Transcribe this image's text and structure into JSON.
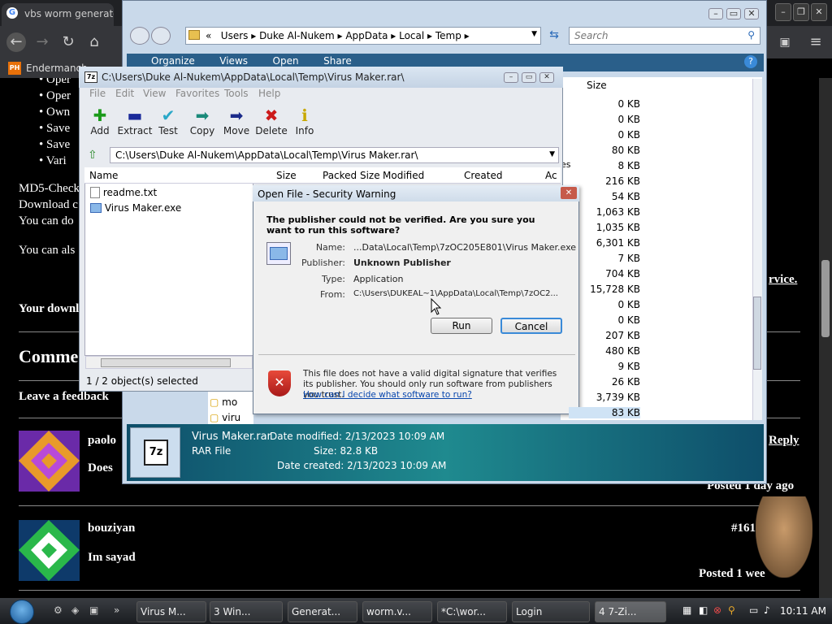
{
  "browser": {
    "tab_title": "vbs worm generato",
    "bookmark": "Endermanch",
    "bookmark_icon": "PH"
  },
  "page": {
    "bullets": [
      "Oper",
      "Oper",
      "Own",
      "Save",
      "Save",
      "Vari"
    ],
    "md5": "MD5-Check",
    "download": "Download c",
    "can_do": "You can do",
    "can_also": "You can als",
    "your_down": "Your downl",
    "service_link": "rvice.",
    "comments_heading": "Comme",
    "leave_feedback": "Leave a feedback",
    "comments": [
      {
        "author": "paolo",
        "text": "Does",
        "reply": "Reply",
        "posted": "Posted 1 day ago"
      },
      {
        "author": "bouziyan",
        "text": "Im sayad",
        "id": "#1610",
        "posted": "Posted 1 wee"
      }
    ]
  },
  "explorer": {
    "breadcrumb": [
      "«",
      "Users",
      "Duke Al-Nukem",
      "AppData",
      "Local",
      "Temp"
    ],
    "search_placeholder": "Search",
    "toolbar": [
      "Organize",
      "Views",
      "Open",
      "Share"
    ],
    "size_header": "Size",
    "sizes": [
      "0 KB",
      "0 KB",
      "0 KB",
      "80 KB",
      "8 KB",
      "216 KB",
      "54 KB",
      "1,063 KB",
      "1,035 KB",
      "6,301 KB",
      "7 KB",
      "704 KB",
      "15,728 KB",
      "0 KB",
      "0 KB",
      "207 KB",
      "480 KB",
      "9 KB",
      "26 KB",
      "3,739 KB",
      "83 KB"
    ],
    "partial_left": [
      "es",
      "mo",
      "viru"
    ],
    "details": {
      "filename": "Virus Maker.rar",
      "type": "RAR File",
      "modified_label": "Date modified:",
      "modified": "2/13/2023 10:09 AM",
      "size_label": "Size:",
      "size": "82.8 KB",
      "created_label": "Date created:",
      "created": "2/13/2023 10:09 AM",
      "icon_text": "7z"
    }
  },
  "zip": {
    "title": "C:\\Users\\Duke Al-Nukem\\AppData\\Local\\Temp\\Virus Maker.rar\\",
    "menu": [
      "File",
      "Edit",
      "View",
      "Favorites",
      "Tools",
      "Help"
    ],
    "toolbar": [
      {
        "label": "Add",
        "icon": "plus-icon",
        "glyph": "✚",
        "color": "#1a9a1a"
      },
      {
        "label": "Extract",
        "icon": "minus-icon",
        "glyph": "▬",
        "color": "#1a2a9a"
      },
      {
        "label": "Test",
        "icon": "check-icon",
        "glyph": "✔",
        "color": "#2aa8c8"
      },
      {
        "label": "Copy",
        "icon": "copy-arrow-icon",
        "glyph": "➡",
        "color": "#1a8a7a"
      },
      {
        "label": "Move",
        "icon": "move-arrow-icon",
        "glyph": "➡",
        "color": "#1a2a8a"
      },
      {
        "label": "Delete",
        "icon": "delete-x-icon",
        "glyph": "✖",
        "color": "#cc1a1a"
      },
      {
        "label": "Info",
        "icon": "info-icon",
        "glyph": "ℹ",
        "color": "#c8a800"
      }
    ],
    "path": "C:\\Users\\Duke Al-Nukem\\AppData\\Local\\Temp\\Virus Maker.rar\\",
    "columns": [
      "Name",
      "Size",
      "Packed Size",
      "Modified",
      "Created",
      "Ac"
    ],
    "files": [
      "readme.txt",
      "Virus Maker.exe"
    ],
    "status": "1 / 2 object(s) selected"
  },
  "dialog": {
    "title": "Open File - Security Warning",
    "question": "The publisher could not be verified.  Are you sure you want to run this software?",
    "name_label": "Name:",
    "name": "...Data\\Local\\Temp\\7zOC205E801\\Virus Maker.exe",
    "publisher_label": "Publisher:",
    "publisher": "Unknown Publisher",
    "type_label": "Type:",
    "type": "Application",
    "from_label": "From:",
    "from": "C:\\Users\\DUKEAL~1\\AppData\\Local\\Temp\\7zOC2...",
    "run": "Run",
    "cancel": "Cancel",
    "warning": "This file does not have a valid digital signature that verifies its publisher.  You should only run software from publishers you trust.",
    "link": "How can I decide what software to run?"
  },
  "taskbar": {
    "items": [
      "Virus M...",
      "3 Win...",
      "Generat...",
      "worm.v...",
      "*C:\\wor...",
      "Login",
      "4 7-Zi..."
    ],
    "clock": "10:11 AM"
  }
}
